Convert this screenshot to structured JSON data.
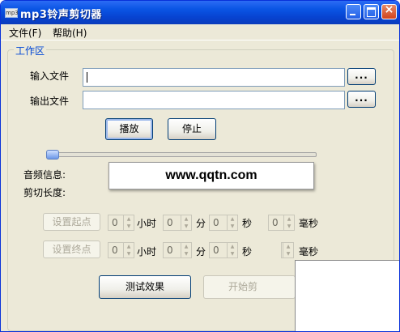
{
  "window": {
    "title": "mp3铃声剪切器",
    "icon_text": "mp3"
  },
  "menu": [
    {
      "label": "文件(F)"
    },
    {
      "label": "帮助(H)"
    }
  ],
  "workspace": {
    "title": "工作区",
    "input_file": {
      "label": "输入文件",
      "value": "",
      "browse_label": "..."
    },
    "output_file": {
      "label": "输出文件",
      "value": "",
      "browse_label": "..."
    },
    "play_label": "播放",
    "stop_label": "停止",
    "slider_position": 0,
    "audio_info_label": "音频信息:",
    "cut_length_label": "剪切长度:",
    "watermark_text": "www.qqtn.com",
    "start_point": {
      "button_label": "设置起点",
      "hours": "0",
      "hours_unit": "小时",
      "minutes": "0",
      "minutes_unit": "分",
      "seconds": "0",
      "seconds_unit": "秒",
      "ms": "0",
      "ms_unit": "毫秒"
    },
    "end_point": {
      "button_label": "设置终点",
      "hours": "0",
      "hours_unit": "小时",
      "minutes": "0",
      "minutes_unit": "分",
      "seconds": "0",
      "seconds_unit": "秒",
      "ms_unit": "毫秒"
    },
    "test_effect_label": "测试效果",
    "start_cut_label": "开始剪"
  },
  "icons": {
    "minimize": "minimize-icon",
    "maximize": "maximize-icon",
    "close": "close-icon"
  }
}
